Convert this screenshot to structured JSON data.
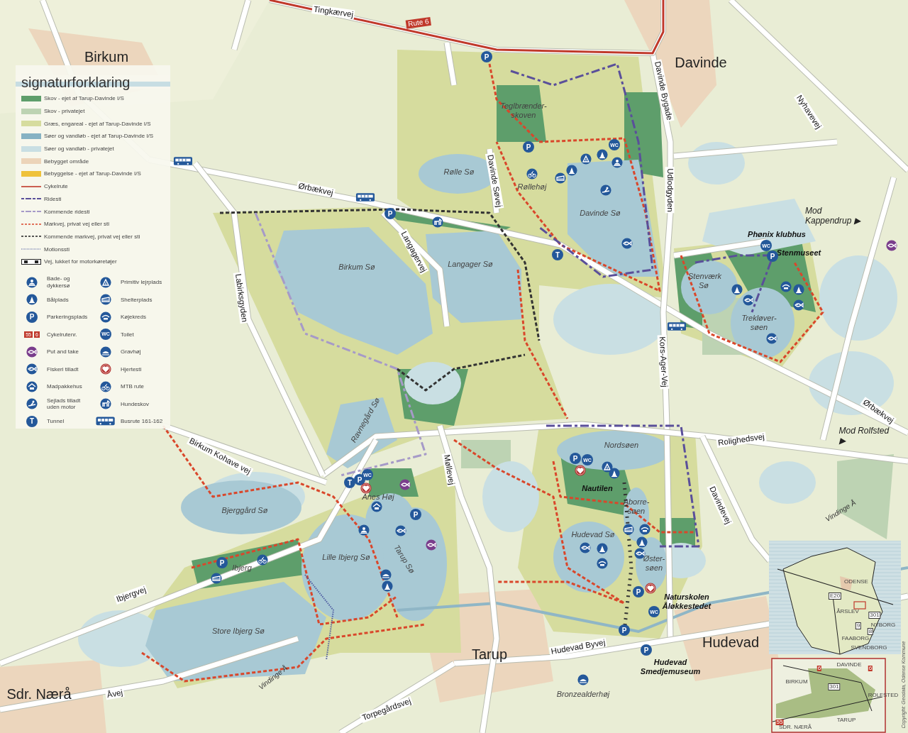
{
  "legend": {
    "title": "signaturforklaring",
    "entries": [
      {
        "kind": "swatch",
        "color": "#5e9e6b",
        "label": "Skov - ejet af Tarup-Davinde I/S"
      },
      {
        "kind": "swatch",
        "color": "#bdd3b3",
        "label": "Skov - privatejet"
      },
      {
        "kind": "swatch",
        "color": "#d6dc9e",
        "label": "Græs, engareal - ejet af Tarup-Davinde I/S"
      },
      {
        "kind": "swatch",
        "color": "#86b2c3",
        "label": "Søer og vandløb - ejet af Tarup-Davinde I/S"
      },
      {
        "kind": "swatch",
        "color": "#c9dfe3",
        "label": "Søer og vandløb - privatejet"
      },
      {
        "kind": "swatch",
        "color": "#ecd4b9",
        "label": "Bebygget område"
      },
      {
        "kind": "swatch",
        "color": "#efc23a",
        "label": "Bebyggelse - ejet af Tarup-Davinde I/S"
      },
      {
        "kind": "cycle",
        "label": "Cykelrute"
      },
      {
        "kind": "ride",
        "label": "Ridesti"
      },
      {
        "kind": "future_ride",
        "label": "Kommende ridesti"
      },
      {
        "kind": "farm",
        "label": "Markvej, privat vej eller sti"
      },
      {
        "kind": "future_farm",
        "label": "Kommende markvej, privat vej eller sti"
      },
      {
        "kind": "fitness",
        "label": "Motionssti"
      },
      {
        "kind": "closed",
        "label": "Vej, lukket for motorkøretøjer"
      }
    ],
    "symbols": [
      {
        "kind": "bathing",
        "label": "Bade- og dykkersø"
      },
      {
        "kind": "fire",
        "label": "Bålplads"
      },
      {
        "kind": "parking",
        "glyph": "P",
        "label": "Parkeringsplads"
      },
      {
        "kind": "route",
        "glyphs": [
          "55",
          "6"
        ],
        "label": "Cykelrutenr."
      },
      {
        "kind": "put_and_take",
        "label": "Put and take"
      },
      {
        "kind": "fishing",
        "label": "Fiskeri tilladt"
      },
      {
        "kind": "lunch_house",
        "label": "Madpakkehus"
      },
      {
        "kind": "sailing",
        "label": "Sejlads tilladt uden motor"
      },
      {
        "kind": "tunnel",
        "glyph": "T",
        "label": "Tunnel"
      },
      {
        "kind": "tent",
        "label": "Primitiv lejrplads"
      },
      {
        "kind": "shelter",
        "label": "Shelterplads"
      },
      {
        "kind": "bunk",
        "label": "Køjekreds"
      },
      {
        "kind": "toilet",
        "glyph": "WC",
        "label": "Toilet"
      },
      {
        "kind": "mound",
        "label": "Gravhøj"
      },
      {
        "kind": "heart",
        "label": "Hjertesti"
      },
      {
        "kind": "mtb",
        "label": "MTB rute"
      },
      {
        "kind": "dog",
        "label": "Hundeskov"
      },
      {
        "kind": "bus",
        "label": "Busrute 161-162"
      }
    ]
  },
  "labels": [
    {
      "kind": "road",
      "text": "Tingkærvej"
    },
    {
      "kind": "route_badge",
      "text": "Rute 6"
    },
    {
      "kind": "town",
      "text": "Birkum"
    },
    {
      "kind": "town",
      "text": "Davinde"
    },
    {
      "kind": "place",
      "text": "Teglbrænder-skoven"
    },
    {
      "kind": "road",
      "text": "Davinde Bygade"
    },
    {
      "kind": "road",
      "text": "Nyhavevej"
    },
    {
      "kind": "place",
      "text": "Rølle Sø"
    },
    {
      "kind": "place",
      "text": "Røllehøj"
    },
    {
      "kind": "road",
      "text": "Davinde Søvej"
    },
    {
      "kind": "road",
      "text": "Udlodgyden"
    },
    {
      "kind": "road",
      "text": "Ørbækvej"
    },
    {
      "kind": "place",
      "text": "Davinde Sø"
    },
    {
      "kind": "direction",
      "text": "Mod Kappendrup ▶"
    },
    {
      "kind": "place_bold",
      "text": "Phønix klubhus"
    },
    {
      "kind": "road",
      "text": "Langagervej"
    },
    {
      "kind": "place_bold",
      "text": "Stenmuseet"
    },
    {
      "kind": "place",
      "text": "Birkum Sø"
    },
    {
      "kind": "place",
      "text": "Langager Sø"
    },
    {
      "kind": "place",
      "text": "Stenværk Sø"
    },
    {
      "kind": "road",
      "text": "Labirksgyden"
    },
    {
      "kind": "place",
      "text": "Trekløver-søen"
    },
    {
      "kind": "road",
      "text": "Kors-Ager-Vej"
    },
    {
      "kind": "road",
      "text": "Ørbækvej"
    },
    {
      "kind": "place",
      "text": "Ravnegård Sø"
    },
    {
      "kind": "direction",
      "text": "Mod Rolfsted ▶"
    },
    {
      "kind": "road",
      "text": "Rolighedsvej"
    },
    {
      "kind": "place",
      "text": "Nordsøen"
    },
    {
      "kind": "road",
      "text": "Birkum Kohave vej"
    },
    {
      "kind": "road",
      "text": "Møllevej"
    },
    {
      "kind": "place_bold",
      "text": "Nautilen"
    },
    {
      "kind": "place",
      "text": "Anes Høj"
    },
    {
      "kind": "road",
      "text": "Davindevej"
    },
    {
      "kind": "place",
      "text": "Bjerggård Sø"
    },
    {
      "kind": "river",
      "text": "Vindinge Å"
    },
    {
      "kind": "place",
      "text": "Aborre-søen"
    },
    {
      "kind": "place",
      "text": "Hudevad Sø"
    },
    {
      "kind": "place",
      "text": "Ibjerg"
    },
    {
      "kind": "place",
      "text": "Lille Ibjerg Sø"
    },
    {
      "kind": "place",
      "text": "Tarup Sø"
    },
    {
      "kind": "place",
      "text": "Øster-søen"
    },
    {
      "kind": "road",
      "text": "Ibjergvej"
    },
    {
      "kind": "place_bold",
      "text": "Naturskolen Åløkkestedet"
    },
    {
      "kind": "place",
      "text": "Store Ibjerg Sø"
    },
    {
      "kind": "town",
      "text": "Hudevad"
    },
    {
      "kind": "town",
      "text": "Tarup"
    },
    {
      "kind": "road",
      "text": "Hudevad Byvej"
    },
    {
      "kind": "place_bold",
      "text": "Hudevad Smedjemuseum"
    },
    {
      "kind": "river",
      "text": "Vindinge Å"
    },
    {
      "kind": "town",
      "text": "Sdr. Nærå"
    },
    {
      "kind": "road",
      "text": "Åvej"
    },
    {
      "kind": "place",
      "text": "Bronzealderhøj"
    },
    {
      "kind": "road",
      "text": "Torpegårdsvej"
    }
  ],
  "markers": [
    {
      "kind": "parking",
      "glyph": "P"
    },
    {
      "kind": "bus"
    },
    {
      "kind": "parking",
      "glyph": "P"
    },
    {
      "kind": "toilet",
      "glyph": "WC"
    },
    {
      "kind": "tent"
    },
    {
      "kind": "fire"
    },
    {
      "kind": "bathing"
    },
    {
      "kind": "mtb"
    },
    {
      "kind": "shelter"
    },
    {
      "kind": "fire"
    },
    {
      "kind": "sailing"
    },
    {
      "kind": "bus"
    },
    {
      "kind": "parking",
      "glyph": "P"
    },
    {
      "kind": "dog"
    },
    {
      "kind": "tunnel",
      "glyph": "T"
    },
    {
      "kind": "fishing"
    },
    {
      "kind": "toilet",
      "glyph": "WC"
    },
    {
      "kind": "parking",
      "glyph": "P"
    },
    {
      "kind": "put_and_take"
    },
    {
      "kind": "fire"
    },
    {
      "kind": "fishing"
    },
    {
      "kind": "bunk"
    },
    {
      "kind": "fire"
    },
    {
      "kind": "fishing"
    },
    {
      "kind": "fishing"
    },
    {
      "kind": "bus"
    },
    {
      "kind": "parking",
      "glyph": "P"
    },
    {
      "kind": "toilet",
      "glyph": "WC"
    },
    {
      "kind": "heart"
    },
    {
      "kind": "tent"
    },
    {
      "kind": "fire"
    },
    {
      "kind": "shelter"
    },
    {
      "kind": "bunk"
    },
    {
      "kind": "fire"
    },
    {
      "kind": "fishing"
    },
    {
      "kind": "fishing"
    },
    {
      "kind": "fire"
    },
    {
      "kind": "bunk"
    },
    {
      "kind": "parking",
      "glyph": "P"
    },
    {
      "kind": "heart"
    },
    {
      "kind": "toilet",
      "glyph": "WC"
    },
    {
      "kind": "parking",
      "glyph": "P"
    },
    {
      "kind": "parking",
      "glyph": "P"
    },
    {
      "kind": "mound"
    },
    {
      "kind": "tunnel",
      "glyph": "T"
    },
    {
      "kind": "parking",
      "glyph": "P"
    },
    {
      "kind": "toilet",
      "glyph": "WC"
    },
    {
      "kind": "heart"
    },
    {
      "kind": "put_and_take"
    },
    {
      "kind": "lunch_house"
    },
    {
      "kind": "parking",
      "glyph": "P"
    },
    {
      "kind": "bathing"
    },
    {
      "kind": "fishing"
    },
    {
      "kind": "put_and_take"
    },
    {
      "kind": "mound"
    },
    {
      "kind": "fire"
    },
    {
      "kind": "parking",
      "glyph": "P"
    },
    {
      "kind": "mtb"
    },
    {
      "kind": "shelter"
    }
  ],
  "inset": {
    "overview_labels": [
      "ODENSE",
      "E20",
      "ÅRSLEV",
      "301",
      "NYBORG",
      "9",
      "8",
      "FAABORG",
      "SVENDBORG"
    ],
    "detail_labels": [
      "DAVINDE",
      "6",
      "6",
      "BIRKUM",
      "301",
      "ROLFSTED",
      "TARUP",
      "55",
      "SDR. NÆRÅ"
    ]
  },
  "copyright": "Copyright: Geodata, Odense Kommune"
}
